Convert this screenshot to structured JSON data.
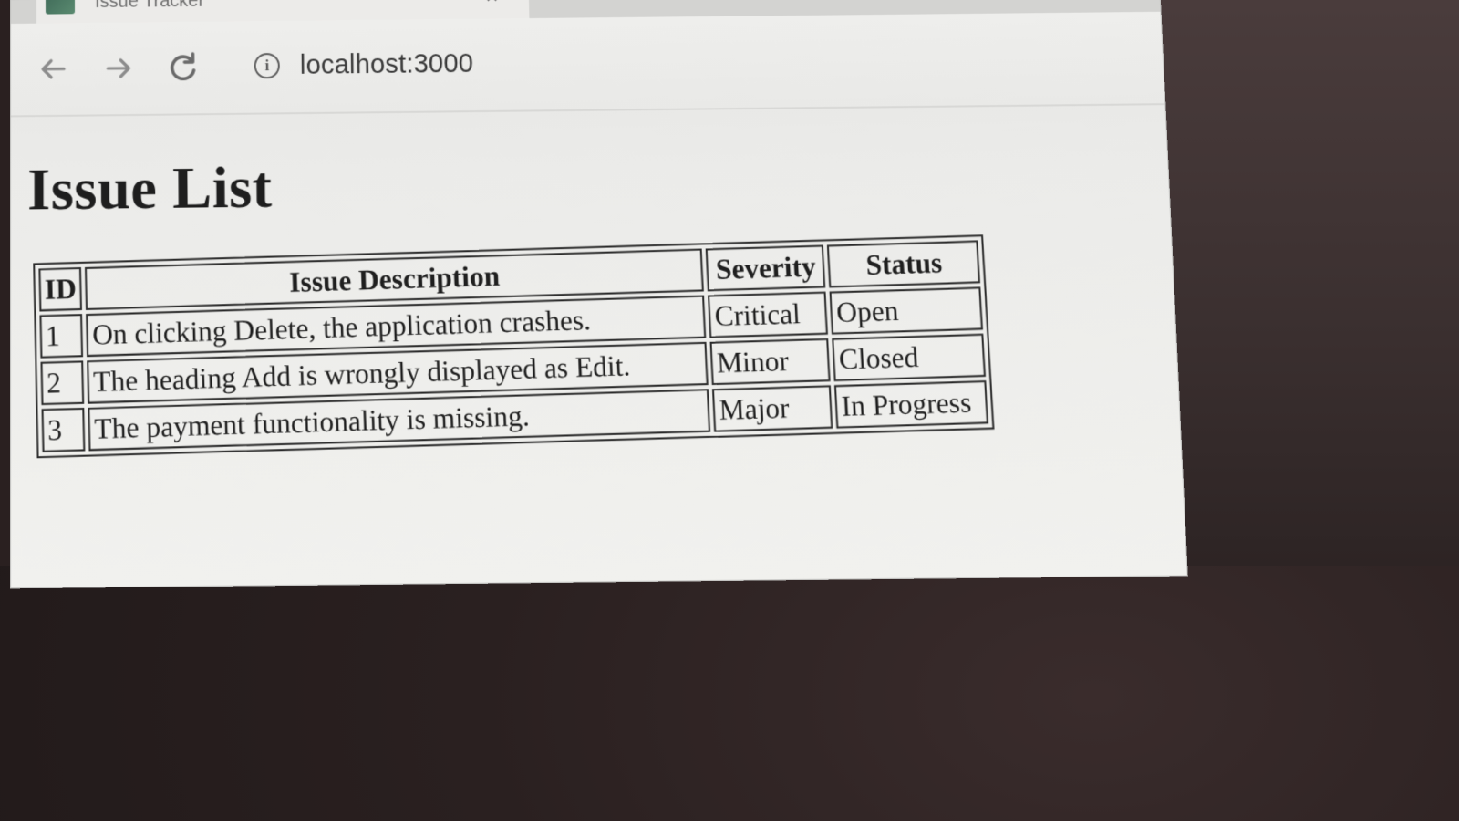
{
  "browser": {
    "tab_title": "Issue Tracker",
    "tab_close_icon": "close-icon",
    "url": "localhost:3000",
    "nav_icons": [
      "back-arrow-icon",
      "forward-arrow-icon",
      "reload-icon",
      "info-icon"
    ]
  },
  "page": {
    "title": "Issue List",
    "table": {
      "headers": [
        "ID",
        "Issue Description",
        "Severity",
        "Status"
      ],
      "rows": [
        [
          "1",
          "On clicking Delete, the application crashes.",
          "Critical",
          "Open"
        ],
        [
          "2",
          "The heading Add is wrongly displayed as Edit.",
          "Minor",
          "Closed"
        ],
        [
          "3",
          "The payment functionality is missing.",
          "Major",
          "In Progress"
        ]
      ]
    }
  }
}
